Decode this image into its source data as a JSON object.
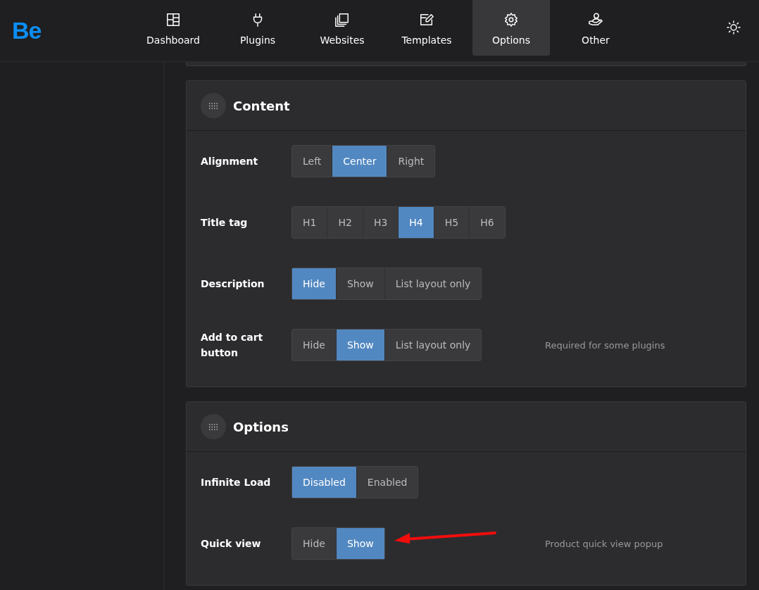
{
  "logo": "Be",
  "nav": [
    {
      "label": "Dashboard",
      "kind": "dashboard",
      "selected": false
    },
    {
      "label": "Plugins",
      "kind": "plug",
      "selected": false
    },
    {
      "label": "Websites",
      "kind": "copies",
      "selected": false
    },
    {
      "label": "Templates",
      "kind": "edit",
      "selected": false
    },
    {
      "label": "Options",
      "kind": "gear",
      "selected": true
    },
    {
      "label": "Other",
      "kind": "hand",
      "selected": false
    }
  ],
  "panels": [
    {
      "title": "Content",
      "rows": [
        {
          "label": "Alignment",
          "options": [
            {
              "label": "Left",
              "selected": false
            },
            {
              "label": "Center",
              "selected": true
            },
            {
              "label": "Right",
              "selected": false
            }
          ]
        },
        {
          "label": "Title tag",
          "options": [
            {
              "label": "H1",
              "selected": false
            },
            {
              "label": "H2",
              "selected": false
            },
            {
              "label": "H3",
              "selected": false
            },
            {
              "label": "H4",
              "selected": true
            },
            {
              "label": "H5",
              "selected": false
            },
            {
              "label": "H6",
              "selected": false
            }
          ]
        },
        {
          "label": "Description",
          "options": [
            {
              "label": "Hide",
              "selected": true
            },
            {
              "label": "Show",
              "selected": false
            },
            {
              "label": "List layout only",
              "selected": false
            }
          ]
        },
        {
          "label": "Add to cart button",
          "options": [
            {
              "label": "Hide",
              "selected": false
            },
            {
              "label": "Show",
              "selected": true
            },
            {
              "label": "List layout only",
              "selected": false
            }
          ],
          "note": "Required for some plugins"
        }
      ]
    },
    {
      "title": "Options",
      "rows": [
        {
          "label": "Infinite Load",
          "options": [
            {
              "label": "Disabled",
              "selected": true
            },
            {
              "label": "Enabled",
              "selected": false
            }
          ]
        },
        {
          "label": "Quick view",
          "options": [
            {
              "label": "Hide",
              "selected": false
            },
            {
              "label": "Show",
              "selected": true
            }
          ],
          "note": "Product quick view popup",
          "arrow": true
        }
      ]
    }
  ]
}
